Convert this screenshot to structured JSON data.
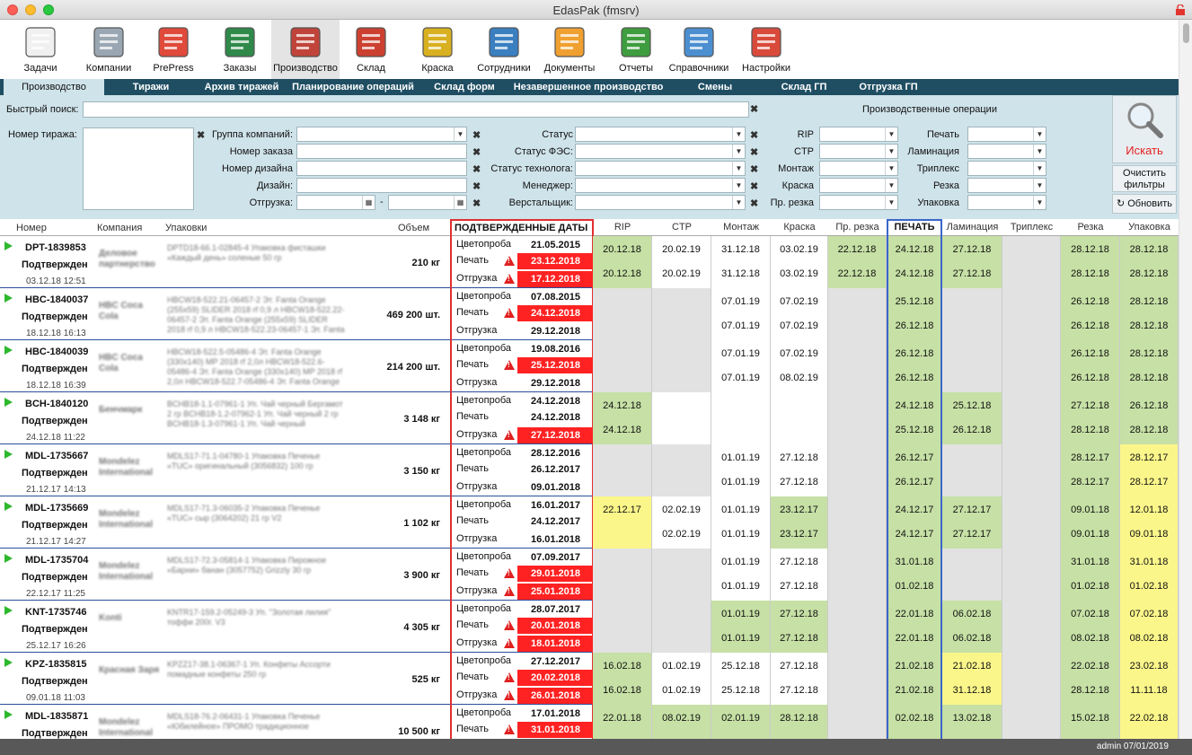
{
  "window": {
    "title": "EdasPak (fmsrv)"
  },
  "toolbar": [
    {
      "label": "Задачи",
      "icon": "tasks-icon"
    },
    {
      "label": "Компании",
      "icon": "companies-icon"
    },
    {
      "label": "PrePress",
      "icon": "prepress-icon"
    },
    {
      "label": "Заказы",
      "icon": "orders-icon"
    },
    {
      "label": "Производство",
      "icon": "production-icon"
    },
    {
      "label": "Склад",
      "icon": "warehouse-icon"
    },
    {
      "label": "Краска",
      "icon": "paint-icon"
    },
    {
      "label": "Сотрудники",
      "icon": "employees-icon"
    },
    {
      "label": "Документы",
      "icon": "documents-icon"
    },
    {
      "label": "Отчеты",
      "icon": "reports-icon"
    },
    {
      "label": "Справочники",
      "icon": "directories-icon"
    },
    {
      "label": "Настройки",
      "icon": "settings-icon"
    }
  ],
  "tabs": [
    "Производство",
    "Тиражи",
    "Архив тиражей",
    "Планирование операций",
    "Склад форм",
    "Незавершенное производство",
    "Смены",
    "Склад ГП",
    "Отгрузка ГП"
  ],
  "filters": {
    "quick_search": "Быстрый поиск:",
    "run_number": "Номер тиража:",
    "company_group": "Группа компаний:",
    "order_number": "Номер заказа",
    "design_number": "Номер дизайна",
    "design": "Дизайн:",
    "shipment": "Отгрузка:",
    "dash": "-",
    "status": "Статус",
    "fes_status": "Статус  ФЭС:",
    "tech_status": "Статус  технолога:",
    "manager": "Менеджер:",
    "layout": "Верстальщик:",
    "ops_title": "Производственные операции",
    "ops_left": [
      "RIP",
      "CTP",
      "Монтаж",
      "Краска",
      "Пр. резка"
    ],
    "ops_right": [
      "Печать",
      "Ламинация",
      "Триплекс",
      "Резка",
      "Упаковка"
    ],
    "search_btn": "Искать",
    "clear_btn": "Очистить фильтры",
    "refresh_btn": "Обновить"
  },
  "headers": {
    "num": "Номер",
    "company": "Компания",
    "pack": "Упаковки",
    "volume": "Объем",
    "dates": "ПОДТВЕРЖДЕННЫЕ ДАТЫ",
    "ops": [
      "RIP",
      "CTP",
      "Монтаж",
      "Краска",
      "Пр. резка",
      "ПЕЧАТЬ",
      "Ламинация",
      "Триплекс",
      "Резка",
      "Упаковка"
    ]
  },
  "date_labels": [
    "Цветопроба",
    "Печать",
    "Отгрузка"
  ],
  "colors": {
    "green": "#c6e0a5",
    "yellow": "#fbf68a",
    "gray": "#e2e2e2",
    "white": "#ffffff",
    "red": "#ff2222",
    "print_border": "#3b66c9"
  },
  "rows": [
    {
      "num": "DPT-1839853",
      "status": "Подтвержден",
      "time": "03.12.18 12:51",
      "company": "Деловое партнерство",
      "pack": "DPTD18-66.1-02845-4 Упаковка фисташки «Каждый день» соленые 50 гр",
      "volume": "210 кг",
      "dates": [
        {
          "v": "21.05.2015",
          "red": false
        },
        {
          "v": "23.12.2018",
          "red": true
        },
        {
          "v": "17.12.2018",
          "red": true
        }
      ],
      "ops": [
        [
          "g",
          "20.12.18",
          "20.12.18"
        ],
        [
          "w",
          "20.02.19",
          "20.02.19"
        ],
        [
          "w",
          "31.12.18",
          "31.12.18"
        ],
        [
          "w",
          "03.02.19",
          "03.02.19"
        ],
        [
          "g",
          "22.12.18",
          "22.12.18"
        ],
        [
          "g",
          "24.12.18",
          "24.12.18"
        ],
        [
          "g",
          "27.12.18",
          "27.12.18"
        ],
        [
          "x",
          "",
          ""
        ],
        [
          "g",
          "28.12.18",
          "28.12.18"
        ],
        [
          "g",
          "28.12.18",
          "28.12.18"
        ]
      ]
    },
    {
      "num": "HBC-1840037",
      "status": "Подтвержден",
      "time": "18.12.18 16:13",
      "company": "HBC Coca Cola",
      "pack": "HBCW18-522.21-06457-2 Эт. Fanta Orange (255x59) SLIDER 2018 rf 0,9 л HBCW18-522.22-06457-2 Эт. Fanta Orange (255x59) SLIDER 2018 rf 0,9 л HBCW18-522.23-06457-1 Эт. Fanta",
      "volume": "469 200 шт.",
      "dates": [
        {
          "v": "07.08.2015",
          "red": false
        },
        {
          "v": "24.12.2018",
          "red": true
        },
        {
          "v": "29.12.2018",
          "red": false
        }
      ],
      "ops": [
        [
          "x",
          "",
          ""
        ],
        [
          "x",
          "",
          ""
        ],
        [
          "w",
          "07.01.19",
          "07.01.19"
        ],
        [
          "w",
          "07.02.19",
          "07.02.19"
        ],
        [
          "x",
          "",
          ""
        ],
        [
          "g",
          "25.12.18",
          "26.12.18"
        ],
        [
          "x",
          "",
          ""
        ],
        [
          "x",
          "",
          ""
        ],
        [
          "g",
          "26.12.18",
          "26.12.18"
        ],
        [
          "g",
          "28.12.18",
          "28.12.18"
        ]
      ]
    },
    {
      "num": "HBC-1840039",
      "status": "Подтвержден",
      "time": "18.12.18 16:39",
      "company": "HBC Coca Cola",
      "pack": "HBCW18-522.5-05486-4 Эт. Fanta Orange (330x140) MP 2018 rf 2,0л HBCW18-522.6-05486-4 Эт. Fanta Orange (330x140) MP 2018 rf 2,0л HBCW18-522.7-05486-4 Эт. Fanta Orange",
      "volume": "214 200 шт.",
      "dates": [
        {
          "v": "19.08.2016",
          "red": false
        },
        {
          "v": "25.12.2018",
          "red": true
        },
        {
          "v": "29.12.2018",
          "red": false
        }
      ],
      "ops": [
        [
          "x",
          "",
          ""
        ],
        [
          "x",
          "",
          ""
        ],
        [
          "w",
          "07.01.19",
          "07.01.19"
        ],
        [
          "w",
          "07.02.19",
          "08.02.19"
        ],
        [
          "x",
          "",
          ""
        ],
        [
          "g",
          "26.12.18",
          "26.12.18"
        ],
        [
          "x",
          "",
          ""
        ],
        [
          "x",
          "",
          ""
        ],
        [
          "g",
          "26.12.18",
          "26.12.18"
        ],
        [
          "g",
          "28.12.18",
          "28.12.18"
        ]
      ]
    },
    {
      "num": "BCH-1840120",
      "status": "Подтвержден",
      "time": "24.12.18 11:22",
      "company": "Бенчмарк",
      "pack": "BCHB18-1.1-07961-1 Уп. Чай черный Бергамот 2 гр BCHB18-1.2-07962-1 Уп. Чай черный 2 гр BCHB18-1.3-07961-1 Уп. Чай черный",
      "volume": "3 148 кг",
      "dates": [
        {
          "v": "24.12.2018",
          "red": false
        },
        {
          "v": "24.12.2018",
          "red": false
        },
        {
          "v": "27.12.2018",
          "red": true
        }
      ],
      "ops": [
        [
          "g",
          "24.12.18",
          "24.12.18"
        ],
        [
          "w",
          "",
          ""
        ],
        [
          "w",
          "",
          ""
        ],
        [
          "w",
          "",
          ""
        ],
        [
          "x",
          "",
          ""
        ],
        [
          "g",
          "24.12.18",
          "25.12.18"
        ],
        [
          "g",
          "25.12.18",
          "26.12.18"
        ],
        [
          "x",
          "",
          ""
        ],
        [
          "g",
          "27.12.18",
          "28.12.18"
        ],
        [
          "g",
          "26.12.18",
          "28.12.18"
        ]
      ]
    },
    {
      "num": "MDL-1735667",
      "status": "Подтвержден",
      "time": "21.12.17 14:13",
      "company": "Mondelez International",
      "pack": "MDLS17-71.1-04780-1 Упаковка Печенье «TUC» оригинальный (3056832) 100 гр",
      "volume": "3 150 кг",
      "dates": [
        {
          "v": "28.12.2016",
          "red": false
        },
        {
          "v": "26.12.2017",
          "red": false
        },
        {
          "v": "09.01.2018",
          "red": false
        }
      ],
      "ops": [
        [
          "x",
          "",
          ""
        ],
        [
          "x",
          "",
          ""
        ],
        [
          "w",
          "01.01.19",
          "01.01.19"
        ],
        [
          "w",
          "27.12.18",
          "27.12.18"
        ],
        [
          "x",
          "",
          ""
        ],
        [
          "g",
          "26.12.17",
          "26.12.17"
        ],
        [
          "x",
          "",
          ""
        ],
        [
          "x",
          "",
          ""
        ],
        [
          "g",
          "28.12.17",
          "28.12.17"
        ],
        [
          "y",
          "28.12.17",
          "28.12.17"
        ]
      ]
    },
    {
      "num": "MDL-1735669",
      "status": "Подтвержден",
      "time": "21.12.17 14:27",
      "company": "Mondelez International",
      "pack": "MDLS17-71.3-06035-2 Упаковка Печенье «TUC» сыр (3064202) 21 гр V2",
      "volume": "1 102 кг",
      "dates": [
        {
          "v": "16.01.2017",
          "red": false
        },
        {
          "v": "24.12.2017",
          "red": false
        },
        {
          "v": "16.01.2018",
          "red": false
        }
      ],
      "ops": [
        [
          "y",
          "22.12.17",
          ""
        ],
        [
          "w",
          "02.02.19",
          "02.02.19"
        ],
        [
          "w",
          "01.01.19",
          "01.01.19"
        ],
        [
          "g",
          "23.12.17",
          "23.12.17"
        ],
        [
          "x",
          "",
          ""
        ],
        [
          "g",
          "24.12.17",
          "24.12.17"
        ],
        [
          "g",
          "27.12.17",
          "27.12.17"
        ],
        [
          "x",
          "",
          ""
        ],
        [
          "g",
          "09.01.18",
          "09.01.18"
        ],
        [
          "y",
          "12.01.18",
          "09.01.18"
        ]
      ]
    },
    {
      "num": "MDL-1735704",
      "status": "Подтвержден",
      "time": "22.12.17 11:25",
      "company": "Mondelez International",
      "pack": "MDLS17-72.3-05814-1 Упаковка Пирожное «Барни» банан (3057752) Grizzly 30 гр",
      "volume": "3 900 кг",
      "dates": [
        {
          "v": "07.09.2017",
          "red": false
        },
        {
          "v": "29.01.2018",
          "red": true
        },
        {
          "v": "25.01.2018",
          "red": true
        }
      ],
      "ops": [
        [
          "x",
          "",
          ""
        ],
        [
          "x",
          "",
          ""
        ],
        [
          "w",
          "01.01.19",
          "01.01.19"
        ],
        [
          "w",
          "27.12.18",
          "27.12.18"
        ],
        [
          "x",
          "",
          ""
        ],
        [
          "g",
          "31.01.18",
          "01.02.18"
        ],
        [
          "x",
          "",
          ""
        ],
        [
          "x",
          "",
          ""
        ],
        [
          "g",
          "31.01.18",
          "01.02.18"
        ],
        [
          "y",
          "31.01.18",
          "01.02.18"
        ]
      ]
    },
    {
      "num": "KNT-1735746",
      "status": "Подтвержден",
      "time": "25.12.17 16:26",
      "company": "Konti",
      "pack": "KNTR17-159.2-05249-3 Уп. \"Золотая лилия\" тоффи 200г. V3",
      "volume": "4 305 кг",
      "dates": [
        {
          "v": "28.07.2017",
          "red": false
        },
        {
          "v": "20.01.2018",
          "red": true
        },
        {
          "v": "18.01.2018",
          "red": true
        }
      ],
      "ops": [
        [
          "x",
          "",
          ""
        ],
        [
          "x",
          "",
          ""
        ],
        [
          "g",
          "01.01.19",
          "01.01.19"
        ],
        [
          "g",
          "27.12.18",
          "27.12.18"
        ],
        [
          "x",
          "",
          ""
        ],
        [
          "g",
          "22.01.18",
          "22.01.18"
        ],
        [
          "g",
          "06.02.18",
          "06.02.18"
        ],
        [
          "x",
          "",
          ""
        ],
        [
          "g",
          "07.02.18",
          "08.02.18"
        ],
        [
          "y",
          "07.02.18",
          "08.02.18"
        ]
      ]
    },
    {
      "num": "KPZ-1835815",
      "status": "Подтвержден",
      "time": "09.01.18 11:03",
      "company": "Красная Заря",
      "pack": "KPZZ17-38.1-06367-1 Уп. Конфеты Ассорти помадные конфеты 250 гр",
      "volume": "525 кг",
      "dates": [
        {
          "v": "27.12.2017",
          "red": false
        },
        {
          "v": "20.02.2018",
          "red": true
        },
        {
          "v": "26.01.2018",
          "red": true
        }
      ],
      "ops": [
        [
          "g",
          "16.02.18",
          "16.02.18"
        ],
        [
          "w",
          "01.02.19",
          "01.02.19"
        ],
        [
          "w",
          "25.12.18",
          "25.12.18"
        ],
        [
          "w",
          "27.12.18",
          "27.12.18"
        ],
        [
          "x",
          "",
          ""
        ],
        [
          "g",
          "21.02.18",
          "21.02.18"
        ],
        [
          "y",
          "21.02.18",
          "31.12.18"
        ],
        [
          "x",
          "",
          ""
        ],
        [
          "g",
          "22.02.18",
          "28.12.18"
        ],
        [
          "y",
          "23.02.18",
          "11.11.18"
        ]
      ]
    },
    {
      "num": "MDL-1835871",
      "status": "Подтвержден",
      "time": "",
      "company": "Mondelez International",
      "pack": "MDLS18-76.2-06431-1 Упаковка Печенье «Юбилейное» ПРОМО традиционное",
      "volume": "10 500 кг",
      "dates": [
        {
          "v": "17.01.2018",
          "red": false
        },
        {
          "v": "31.01.2018",
          "red": true
        },
        {
          "v": "",
          "red": false
        }
      ],
      "ops": [
        [
          "g",
          "22.01.18",
          ""
        ],
        [
          "g",
          "08.02.19",
          ""
        ],
        [
          "g",
          "02.01.19",
          ""
        ],
        [
          "g",
          "28.12.18",
          ""
        ],
        [
          "x",
          "",
          ""
        ],
        [
          "g",
          "02.02.18",
          ""
        ],
        [
          "g",
          "13.02.18",
          ""
        ],
        [
          "x",
          "",
          ""
        ],
        [
          "g",
          "15.02.18",
          ""
        ],
        [
          "y",
          "22.02.18",
          ""
        ]
      ]
    }
  ],
  "status_bar": {
    "text": "admin 07/01/2019"
  }
}
